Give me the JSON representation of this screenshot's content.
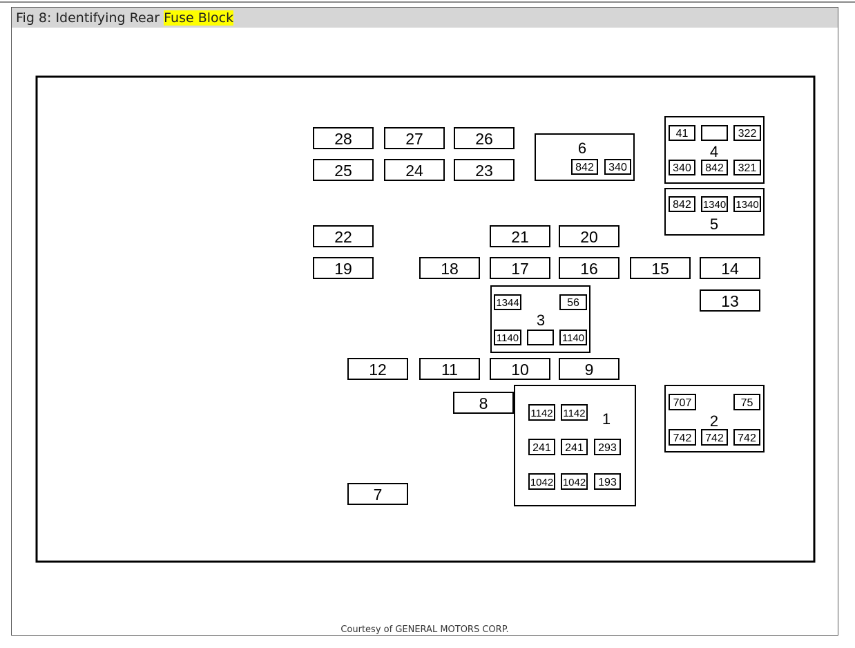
{
  "caption": {
    "prefix": "Fig 8: Identifying Rear ",
    "highlight": "Fuse Block"
  },
  "fuses": [
    "28",
    "27",
    "26",
    "25",
    "24",
    "23",
    "22",
    "21",
    "20",
    "19",
    "18",
    "17",
    "16",
    "15",
    "14",
    "13",
    "12",
    "11",
    "10",
    "9",
    "8",
    "7"
  ],
  "relay_blocks": {
    "block_1": {
      "label": "1",
      "circuits": [
        "1142",
        "1142",
        "241",
        "241",
        "293",
        "1042",
        "1042",
        "193"
      ]
    },
    "block_2": {
      "label": "2",
      "circuits": [
        "707",
        "75",
        "742",
        "742",
        "742"
      ]
    },
    "block_3": {
      "label": "3",
      "circuits": [
        "1344",
        "56",
        "1140",
        "",
        "1140"
      ]
    },
    "block_4": {
      "label": "4",
      "circuits": [
        "41",
        "",
        "322",
        "340",
        "842",
        "321"
      ]
    },
    "block_5": {
      "label": "5",
      "circuits": [
        "842",
        "1340",
        "1340"
      ]
    },
    "block_6": {
      "label": "6",
      "circuits": [
        "842",
        "340"
      ]
    }
  },
  "footer": {
    "courtesy": "Courtesy of GENERAL MOTORS CORP."
  }
}
